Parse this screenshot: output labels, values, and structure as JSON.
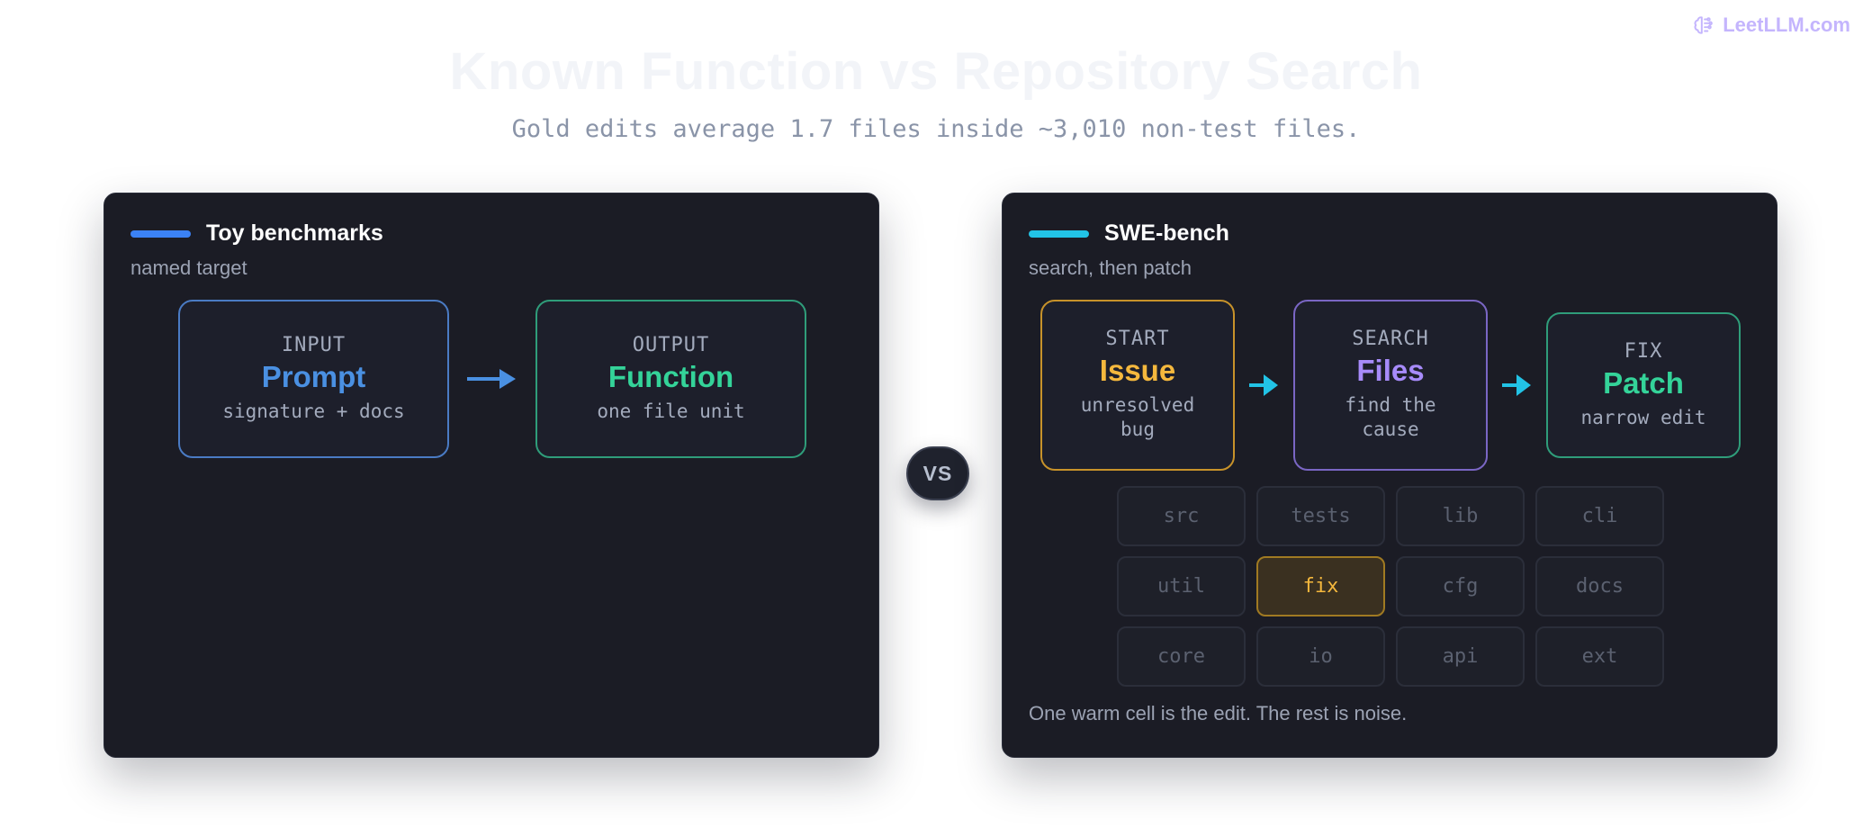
{
  "brand": {
    "label": "LeetLLM.com",
    "icon": "brain-icon",
    "color": "#c4b5fd"
  },
  "header": {
    "title": "Known Function vs Repository Search",
    "subtitle": "Gold edits average 1.7 files inside ~3,010 non-test files."
  },
  "left_panel": {
    "title": "Toy benchmarks",
    "subtitle": "named target",
    "accent": "#3b82f6",
    "nodes": [
      {
        "tag": "INPUT",
        "name": "Prompt",
        "desc": "signature + docs",
        "color": "#4a90e2"
      },
      {
        "tag": "OUTPUT",
        "name": "Function",
        "desc": "one file unit",
        "color": "#34d399"
      }
    ]
  },
  "vs_label": "VS",
  "right_panel": {
    "title": "SWE-bench",
    "subtitle": "search, then patch",
    "accent": "#22c3e6",
    "nodes": [
      {
        "tag": "START",
        "name": "Issue",
        "desc": "unresolved bug",
        "color": "#f5b83d"
      },
      {
        "tag": "SEARCH",
        "name": "Files",
        "desc": "find the cause",
        "color": "#a78bfa"
      },
      {
        "tag": "FIX",
        "name": "Patch",
        "desc": "narrow edit",
        "color": "#34d399"
      }
    ],
    "grid_cells": [
      "src",
      "tests",
      "lib",
      "cli",
      "util",
      "fix",
      "cfg",
      "docs",
      "core",
      "io",
      "api",
      "ext"
    ],
    "highlighted_cell": "fix",
    "caption": "One warm cell is the edit. The rest is noise."
  }
}
